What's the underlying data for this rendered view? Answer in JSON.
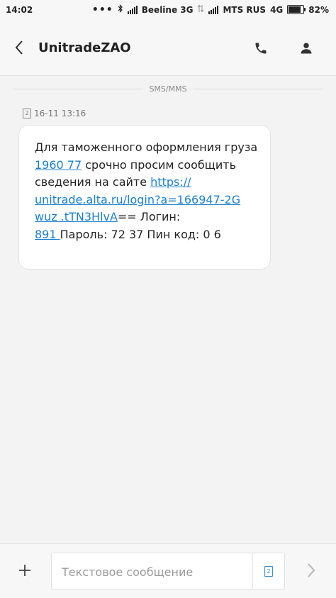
{
  "status_bar": {
    "time": "14:02",
    "carrier1": "Beeline 3G",
    "carrier2": "MTS RUS",
    "network2": "4G",
    "battery": "82%",
    "battery_level": 0.82
  },
  "header": {
    "title": "UnitradeZAO",
    "icons": {
      "back": "back-arrow-icon",
      "call": "phone-icon",
      "contact": "contact-person-icon"
    }
  },
  "conversation": {
    "divider_label": "SMS/MMS",
    "message": {
      "sim_badge": "2",
      "timestamp": "16-11 13:16",
      "text_part1": "Для таможенного оформления груза ",
      "link_cargo": "1960      77",
      "text_part2": " срочно просим сообщить сведения на сайте ",
      "link_url": "https://\nunitrade.alta.ru/login?a=166947-2G\nwuz              .tTN3HlvA",
      "text_part3": "== Логин:\n",
      "link_login": "891              ",
      "text_part4": " Пароль: 72       37 Пин код: 0    6"
    }
  },
  "compose": {
    "placeholder": "Текстовое сообщение",
    "sim_badge": "2",
    "icons": {
      "add": "plus-icon",
      "send": "send-chevron-icon"
    }
  },
  "colors": {
    "link": "#1a7fd0",
    "sim_active": "#3a8fd8",
    "background": "#f3f3f3"
  }
}
